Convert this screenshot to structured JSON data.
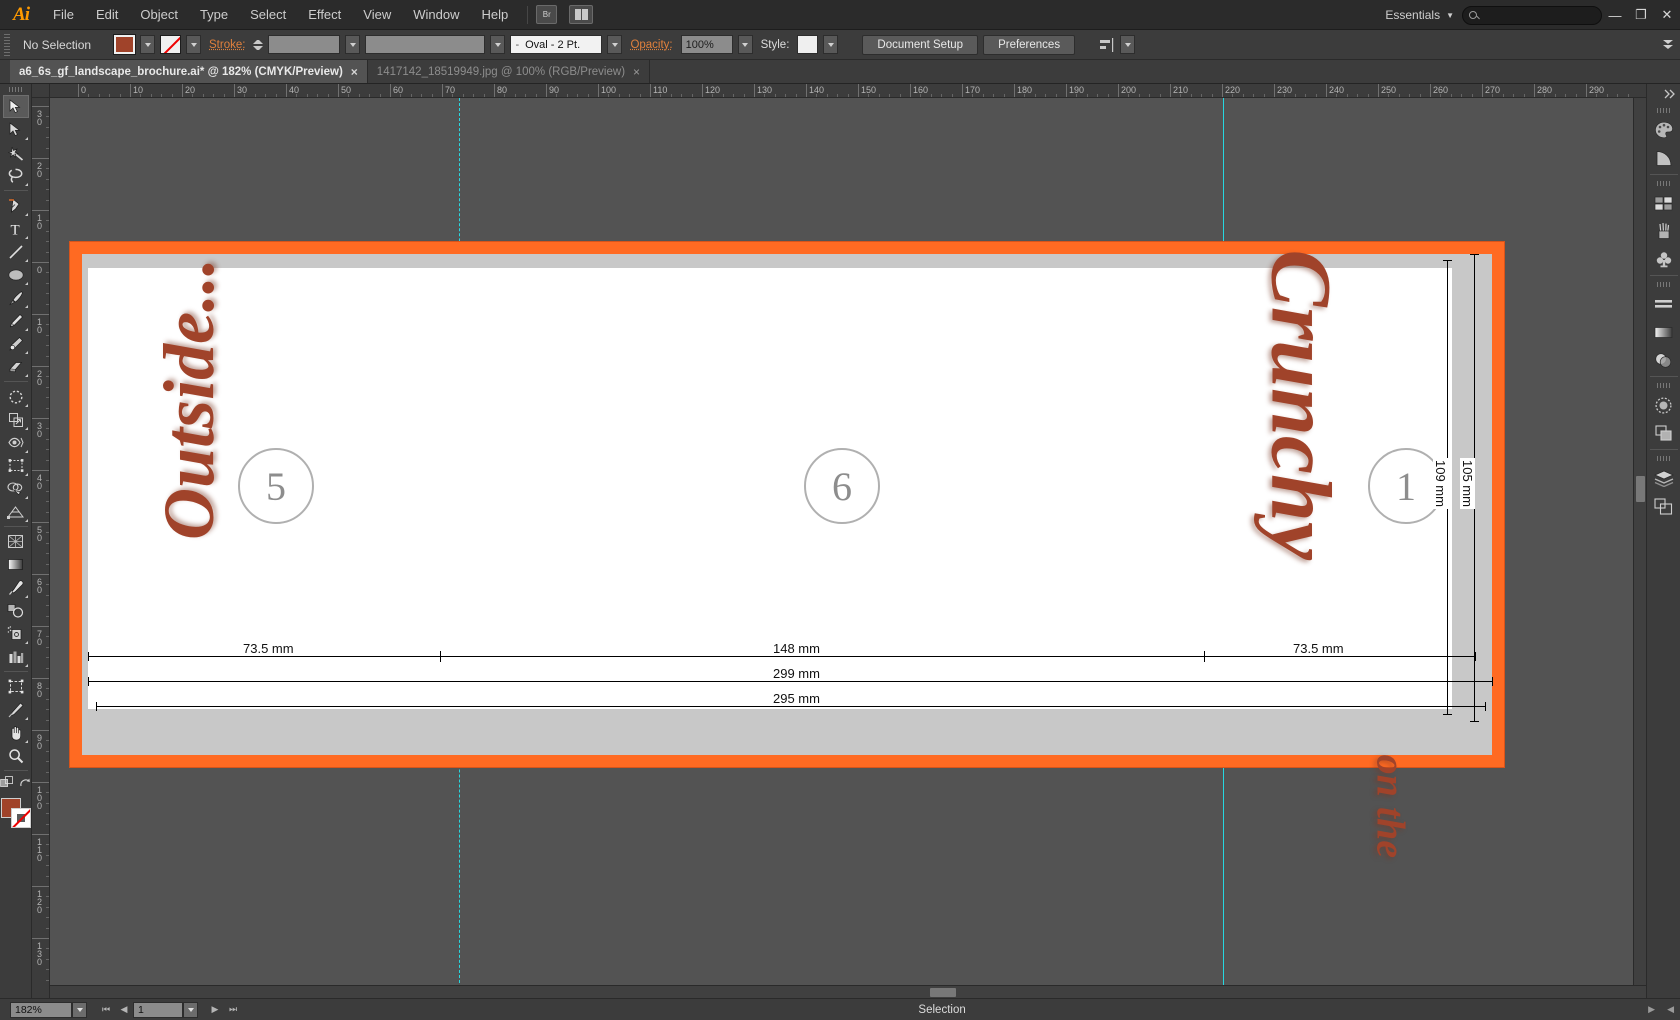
{
  "app": {
    "name": "Adobe Illustrator",
    "logo": "Ai"
  },
  "menubar": {
    "items": [
      "File",
      "Edit",
      "Object",
      "Type",
      "Select",
      "Effect",
      "View",
      "Window",
      "Help"
    ],
    "bridge_label": "Br",
    "workspace_label": "Essentials",
    "search_placeholder": "",
    "window_buttons": {
      "minimize": "—",
      "restore": "❐",
      "close": "✕"
    }
  },
  "controlbar": {
    "selection_status": "No Selection",
    "fill_color": "#a0432a",
    "stroke_label": "Stroke:",
    "stroke_weight": "",
    "profile_value": "",
    "brush_value": "Oval - 2 Pt.",
    "opacity_label": "Opacity:",
    "opacity_value": "100%",
    "style_label": "Style:",
    "document_setup_label": "Document Setup",
    "preferences_label": "Preferences"
  },
  "tabs": [
    {
      "title": "a6_6s_gf_landscape_brochure.ai* @ 182% (CMYK/Preview)",
      "active": true,
      "close": "×"
    },
    {
      "title": "1417142_18519949.jpg @ 100% (RGB/Preview)",
      "active": false,
      "close": "×"
    }
  ],
  "toolbar": {
    "tools": [
      "selection-tool",
      "direct-selection-tool",
      "magic-wand-tool",
      "lasso-tool",
      "pen-tool",
      "type-tool",
      "line-segment-tool",
      "ellipse-tool",
      "paintbrush-tool",
      "pencil-tool",
      "blob-brush-tool",
      "eraser-tool",
      "rotate-tool",
      "scale-tool",
      "width-tool",
      "free-transform-tool",
      "shape-builder-tool",
      "perspective-grid-tool",
      "mesh-tool",
      "gradient-tool",
      "eyedropper-tool",
      "blend-tool",
      "symbol-sprayer-tool",
      "column-graph-tool",
      "artboard-tool",
      "slice-tool",
      "hand-tool",
      "zoom-tool"
    ],
    "fill_color": "#a0432a",
    "stroke_color": "none"
  },
  "rulers": {
    "unit": "mm",
    "horizontal_labels": [
      "0",
      "10",
      "20",
      "30",
      "40",
      "50",
      "60",
      "70",
      "80",
      "90",
      "100",
      "110",
      "120",
      "130",
      "140",
      "150",
      "160",
      "170",
      "180",
      "190",
      "200",
      "210",
      "220",
      "230",
      "240",
      "250",
      "260",
      "270",
      "280",
      "290"
    ],
    "vertical_labels": [
      "30",
      "20",
      "10",
      "0",
      "10",
      "20",
      "30",
      "40",
      "50",
      "60",
      "70",
      "80",
      "90",
      "100",
      "110",
      "120",
      "130"
    ]
  },
  "canvas": {
    "page_numbers": [
      "5",
      "6",
      "1"
    ],
    "artwork_text": {
      "outside": "Outside...",
      "crunchy": "Crunchy",
      "on_the": "on the"
    },
    "artwork_color": "#a0432a",
    "artboard_border_color": "#ff6a22",
    "guide_color": "#27d7e0",
    "dimensions": {
      "panel_left": "73.5 mm",
      "panel_center": "148 mm",
      "panel_right": "73.5 mm",
      "total_width_outer": "299 mm",
      "total_width_inner": "295 mm",
      "height_outer": "109 mm",
      "height_inner": "105 mm"
    }
  },
  "dock": {
    "panels": [
      "color-panel",
      "color-guide-panel",
      "swatches-panel",
      "brushes-panel",
      "symbols-panel",
      "align-panel",
      "gradient-panel",
      "transparency-panel",
      "transform-panel",
      "pathfinder-panel",
      "layers-panel",
      "artboards-panel"
    ]
  },
  "statusbar": {
    "zoom_level": "182%",
    "page_number": "1",
    "status_text": "Selection"
  }
}
